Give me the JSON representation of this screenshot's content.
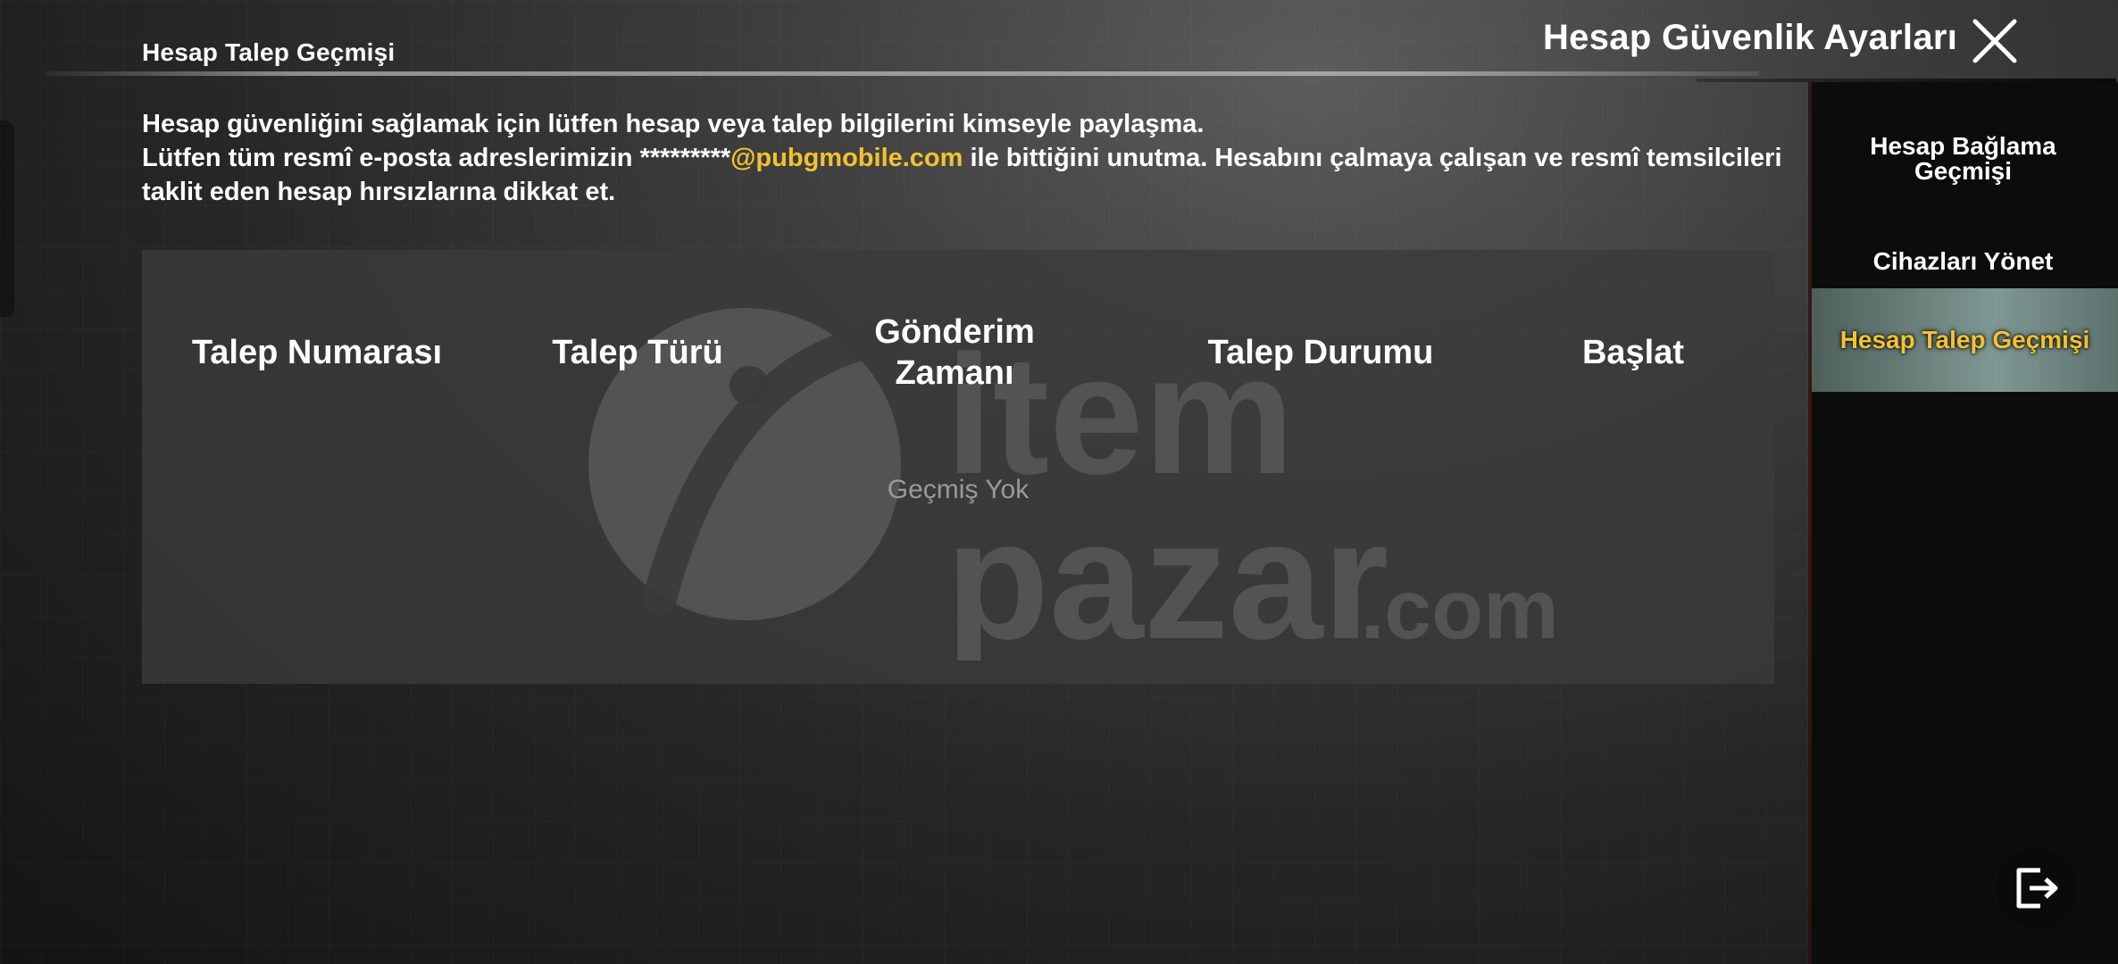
{
  "page": {
    "breadcrumb_title": "Hesap Talep Geçmişi"
  },
  "header": {
    "title": "Hesap Güvenlik Ayarları",
    "close_icon": "close-icon"
  },
  "notice": {
    "line1": "Hesap güvenliğini sağlamak için lütfen hesap veya talep bilgilerini kimseyle paylaşma.",
    "line2_prefix": "Lütfen tüm resmî e-posta adreslerimizin *********",
    "line2_email": "@pubgmobile.com",
    "line2_suffix": " ile bittiğini unutma. Hesabını çalmaya çalışan ve resmî temsilcileri taklit eden hesap hırsızlarına dikkat et.",
    "highlight_color": "#f2c230"
  },
  "table": {
    "columns": [
      "Talep Numarası",
      "Talep Türü",
      "Gönderim Zamanı",
      "Talep Durumu",
      "Başlat"
    ],
    "empty_text": "Geçmiş Yok"
  },
  "watermark": {
    "line1": "item",
    "line2": "pazar",
    "suffix": ".com"
  },
  "sidebar": {
    "items": [
      {
        "label": "Hesap Bağlama Geçmişi",
        "active": false
      },
      {
        "label": "Cihazları Yönet",
        "active": false
      },
      {
        "label": "Hesap Talep Geçmişi",
        "active": true
      }
    ],
    "active_color": "#f2c230"
  },
  "footer": {
    "exit_icon": "exit-icon"
  }
}
